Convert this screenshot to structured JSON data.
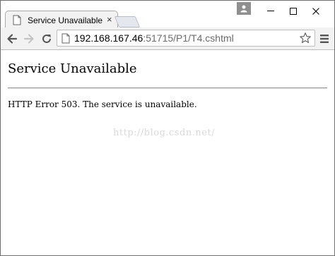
{
  "tab": {
    "title": "Service Unavailable",
    "close_glyph": "×",
    "icon": "page-icon"
  },
  "window_controls": {
    "minimize": "minimize-icon",
    "maximize": "maximize-icon",
    "close": "close-icon",
    "profile": "person-icon"
  },
  "toolbar": {
    "back": "back-arrow-icon",
    "forward": "forward-arrow-icon",
    "reload": "reload-icon",
    "url_host": "192.168.167.46",
    "url_rest": ":51715/P1/T4.cshtml",
    "star": "star-icon",
    "menu": "hamburger-menu-icon"
  },
  "page": {
    "heading": "Service Unavailable",
    "message": "HTTP Error 503. The service is unavailable.",
    "watermark": "http://blog.csdn.net/"
  },
  "colors": {
    "chrome_bg": "#f2f2f2",
    "border": "#bcbcbc",
    "url_rest": "#6b6b6b",
    "watermark": "#d9d9d9"
  }
}
